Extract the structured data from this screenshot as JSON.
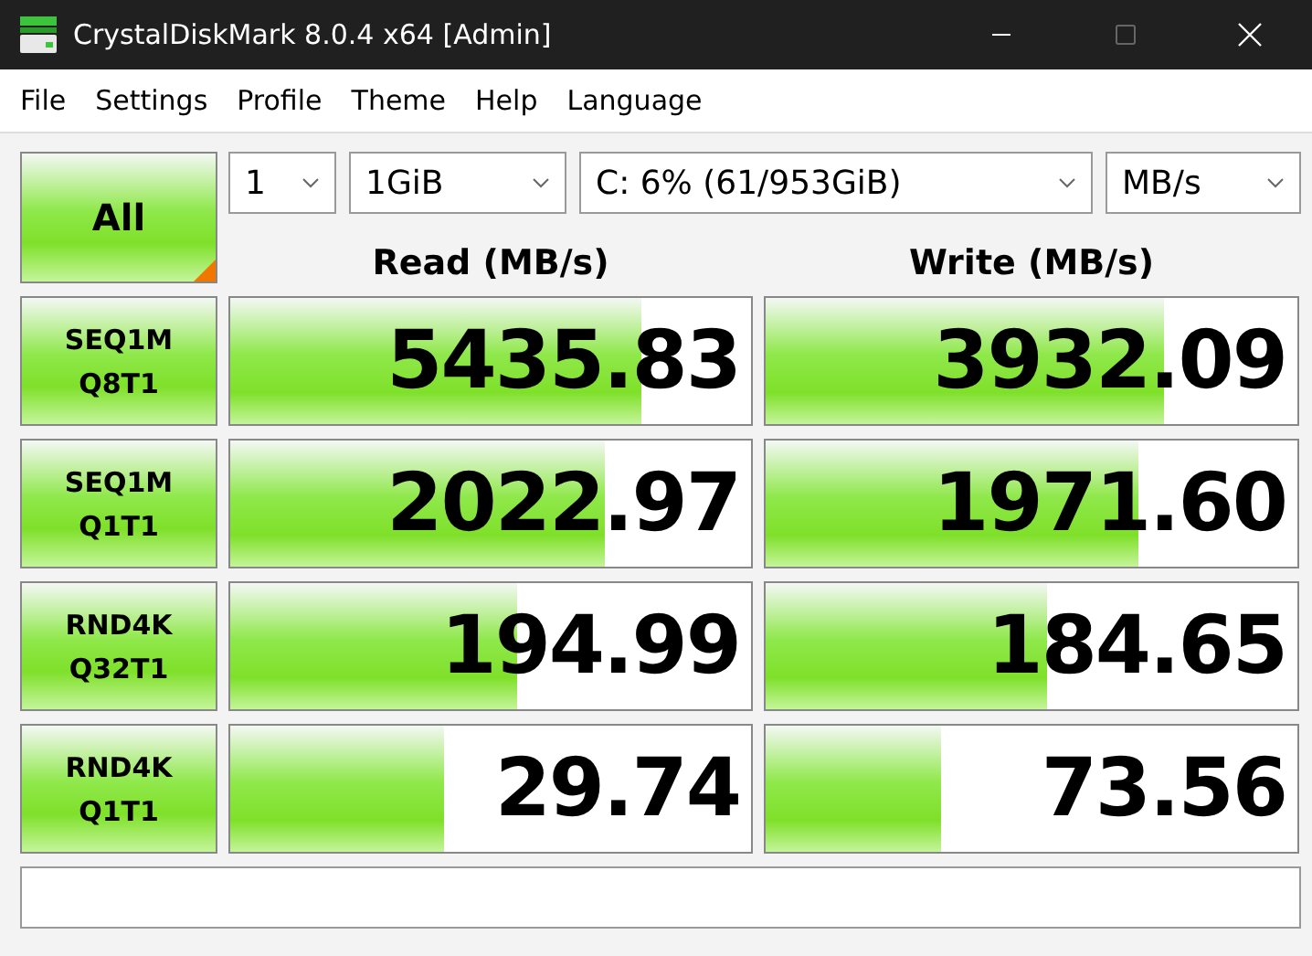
{
  "window": {
    "title": "CrystalDiskMark 8.0.4 x64 [Admin]",
    "maximize_disabled": true
  },
  "menu": [
    "File",
    "Settings",
    "Profile",
    "Theme",
    "Help",
    "Language"
  ],
  "all_button": "All",
  "selectors": [
    {
      "value": "1",
      "kind": "count"
    },
    {
      "value": "1GiB",
      "kind": "size"
    },
    {
      "value": "C: 6% (61/953GiB)",
      "kind": "drive"
    },
    {
      "value": "MB/s",
      "kind": "unit"
    }
  ],
  "headers": {
    "read": "Read (MB/s)",
    "write": "Write (MB/s)"
  },
  "tests": [
    {
      "name": "SEQ1M",
      "params": "Q8T1",
      "read": {
        "value": "5435.83",
        "level": 0.79
      },
      "write": {
        "value": "3932.09",
        "level": 0.75
      }
    },
    {
      "name": "SEQ1M",
      "params": "Q1T1",
      "read": {
        "value": "2022.97",
        "level": 0.72
      },
      "write": {
        "value": "1971.60",
        "level": 0.7
      }
    },
    {
      "name": "RND4K",
      "params": "Q32T1",
      "read": {
        "value": "194.99",
        "level": 0.55
      },
      "write": {
        "value": "184.65",
        "level": 0.53
      }
    },
    {
      "name": "RND4K",
      "params": "Q1T1",
      "read": {
        "value": "29.74",
        "level": 0.41
      },
      "write": {
        "value": "73.56",
        "level": 0.33
      }
    }
  ]
}
